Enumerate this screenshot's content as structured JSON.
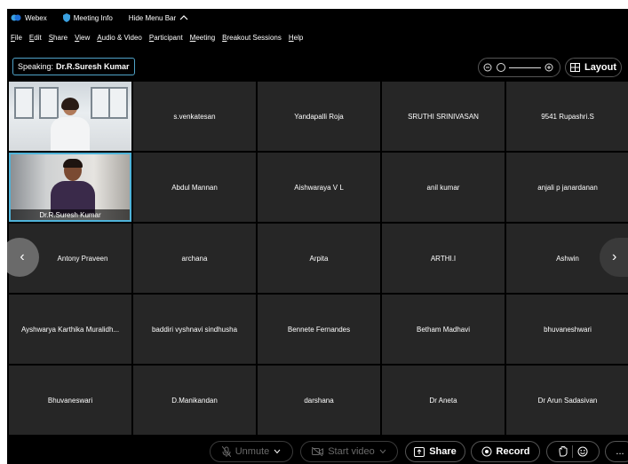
{
  "titlebar": {
    "app_name": "Webex",
    "meeting_info": "Meeting Info",
    "hide_menu_bar": "Hide Menu Bar"
  },
  "menu": [
    "File",
    "Edit",
    "Share",
    "View",
    "Audio & Video",
    "Participant",
    "Meeting",
    "Breakout Sessions",
    "Help"
  ],
  "speaking": {
    "label": "Speaking:",
    "name": "Dr.R.Suresh Kumar"
  },
  "layout_label": "Layout",
  "participants": [
    {
      "name": ""
    },
    {
      "name": "s.venkatesan"
    },
    {
      "name": "Yandapalli Roja"
    },
    {
      "name": "SRUTHI SRINIVASAN"
    },
    {
      "name": "9541 Rupashri.S"
    },
    {
      "name": "Dr.R.Suresh Kumar"
    },
    {
      "name": "Abdul Mannan"
    },
    {
      "name": "Aishwaraya V L"
    },
    {
      "name": "anil kumar"
    },
    {
      "name": "anjali p janardanan"
    },
    {
      "name": "Antony Praveen"
    },
    {
      "name": "archana"
    },
    {
      "name": "Arpita"
    },
    {
      "name": "ARTHI.I"
    },
    {
      "name": "Ashwin"
    },
    {
      "name": "Ayshwarya Karthika Muralidh..."
    },
    {
      "name": "baddiri vyshnavi sindhusha"
    },
    {
      "name": "Bennete Fernandes"
    },
    {
      "name": "Betham Madhavi"
    },
    {
      "name": "bhuvaneshwari"
    },
    {
      "name": "Bhuvaneswari"
    },
    {
      "name": "D.Manikandan"
    },
    {
      "name": "darshana"
    },
    {
      "name": "Dr Aneta"
    },
    {
      "name": "Dr Arun Sadasivan"
    }
  ],
  "controls": {
    "unmute": "Unmute",
    "start_video": "Start video",
    "share": "Share",
    "record": "Record",
    "more": "..."
  },
  "colors": {
    "background": "#000000",
    "tile": "#262626",
    "accent": "#4fb3d9"
  }
}
